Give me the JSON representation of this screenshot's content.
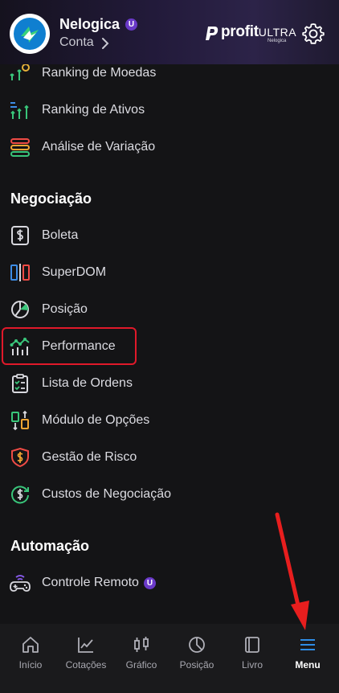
{
  "header": {
    "user_name": "Nelogica",
    "user_badge": "U",
    "account_label": "Conta",
    "brand_main": "profit",
    "brand_ultra": "ULTRA",
    "brand_sub": "Nelogica"
  },
  "menu": {
    "partial_item": "Ranking de Moedas",
    "items_top": [
      {
        "label": "Ranking de Ativos",
        "icon": "ranking-bars-icon"
      },
      {
        "label": "Análise de Variação",
        "icon": "stacked-layers-icon"
      }
    ],
    "section_negociacao": "Negociação",
    "negociacao_items": [
      {
        "label": "Boleta",
        "icon": "dollar-ticket-icon"
      },
      {
        "label": "SuperDOM",
        "icon": "superdom-icon"
      },
      {
        "label": "Posição",
        "icon": "pie-icon"
      },
      {
        "label": "Performance",
        "icon": "performance-chart-icon"
      },
      {
        "label": "Lista de Ordens",
        "icon": "clipboard-icon"
      },
      {
        "label": "Módulo de Opções",
        "icon": "options-icon"
      },
      {
        "label": "Gestão de Risco",
        "icon": "shield-dollar-icon"
      },
      {
        "label": "Custos de Negociação",
        "icon": "dollar-cycle-icon"
      }
    ],
    "section_automacao": "Automação",
    "automacao_items": [
      {
        "label": "Controle Remoto",
        "icon": "gamepad-icon",
        "badge": "U"
      }
    ],
    "highlighted_item": "Performance"
  },
  "tabbar": {
    "tabs": [
      {
        "label": "Início",
        "icon": "home-icon"
      },
      {
        "label": "Cotações",
        "icon": "line-chart-icon"
      },
      {
        "label": "Gráfico",
        "icon": "candles-icon"
      },
      {
        "label": "Posição",
        "icon": "pie-icon"
      },
      {
        "label": "Livro",
        "icon": "book-icon"
      },
      {
        "label": "Menu",
        "icon": "hamburger-icon"
      }
    ],
    "active_tab": "Menu"
  },
  "colors": {
    "accent": "#2e8de6",
    "highlight": "#e0192a",
    "badge": "#6a39c9"
  }
}
